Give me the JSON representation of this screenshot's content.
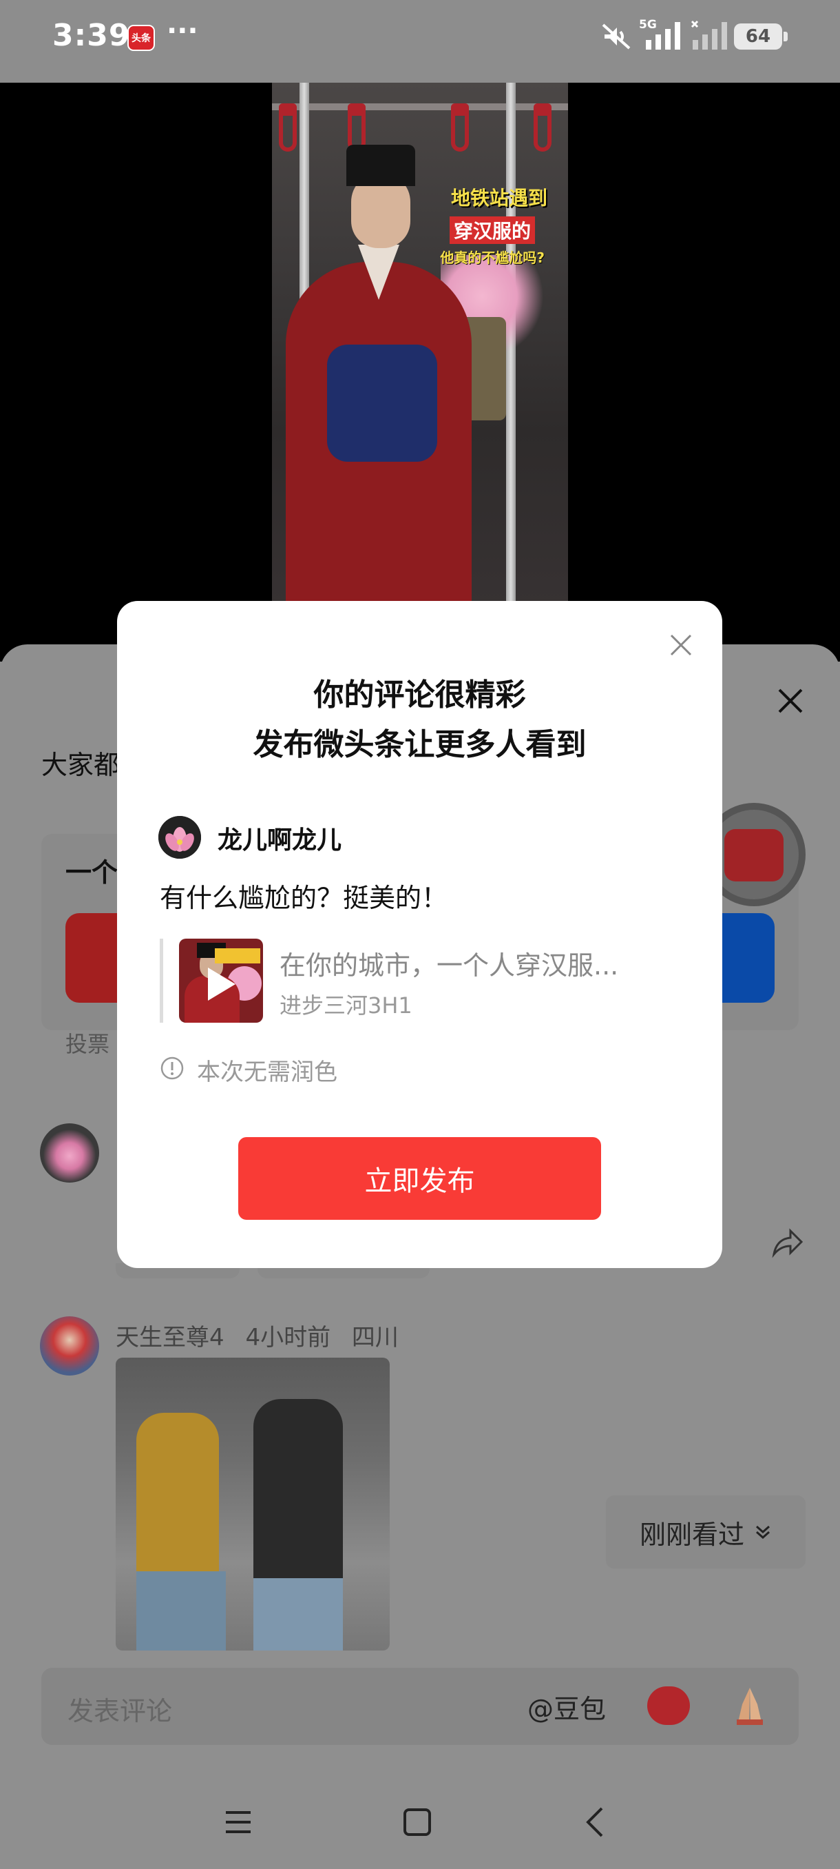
{
  "status_bar": {
    "time": "3:39",
    "app_badge": "头条",
    "more": "···",
    "signal_label": "5G",
    "battery": "64"
  },
  "video": {
    "caption_line1": "地铁站遇到",
    "caption_line2": "穿汉服的",
    "caption_line3": "他真的不尴尬吗?"
  },
  "sheet": {
    "heading": "大家都",
    "poll_title": "一个",
    "poll_label": "投票",
    "comment2_user": "天生至尊4",
    "comment2_time": "4小时前",
    "comment2_location": "四川",
    "recent_label": "刚刚看过",
    "input_placeholder": "发表评论",
    "mention_label": "@豆包"
  },
  "modal": {
    "title_line1": "你的评论很精彩",
    "title_line2": "发布微头条让更多人看到",
    "username": "龙儿啊龙儿",
    "comment_text": "有什么尴尬的？挺美的！",
    "video_title": "在你的城市，一个人穿汉服...",
    "video_author": "进步三河3H1",
    "info_text": "本次无需润色",
    "publish_button": "立即发布"
  },
  "colors": {
    "accent_red": "#f93b36",
    "poll_blue": "#0a4aa8",
    "overlay_gray": "#8f8f8f"
  },
  "icons": [
    "close-icon",
    "share-icon",
    "info-icon",
    "chevron-down-icon",
    "menu-icon",
    "home-icon",
    "back-icon",
    "mute-icon",
    "signal-icon"
  ]
}
